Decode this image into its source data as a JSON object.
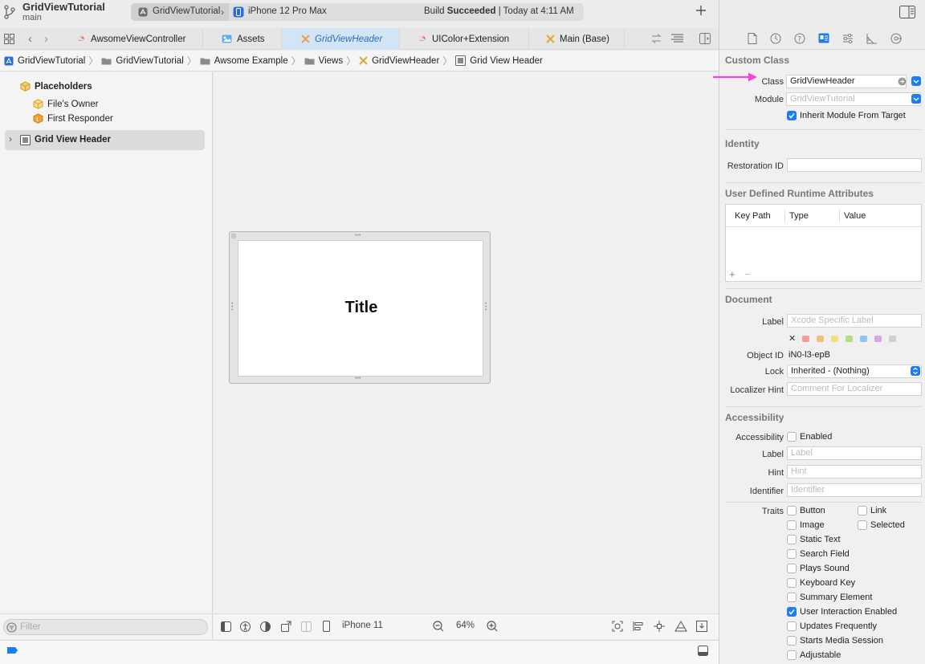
{
  "window": {
    "project_name": "GridViewTutorial",
    "branch": "main",
    "scheme": "GridViewTutorial",
    "device": "iPhone 12 Pro Max",
    "build_status_prefix": "Build ",
    "build_status_bold": "Succeeded",
    "build_status_suffix": " | Today at 4:11 AM"
  },
  "tabs": [
    {
      "label": "AwsomeViewController",
      "icon": "swift-icon"
    },
    {
      "label": "Assets",
      "icon": "assets-icon"
    },
    {
      "label": "GridViewHeader",
      "icon": "xib-icon",
      "active": true
    },
    {
      "label": "UIColor+Extension",
      "icon": "swift-icon"
    },
    {
      "label": "Main (Base)",
      "icon": "xib-icon"
    }
  ],
  "breadcrumb": [
    "GridViewTutorial",
    "GridViewTutorial",
    "Awsome Example",
    "Views",
    "GridViewHeader",
    "Grid View Header"
  ],
  "navigator": {
    "placeholders": "Placeholders",
    "files_owner": "File's Owner",
    "first_responder": "First Responder",
    "grid_view_header": "Grid View Header",
    "filter_placeholder": "Filter"
  },
  "canvas": {
    "view_title": "Title",
    "device": "iPhone 11",
    "zoom": "64%"
  },
  "inspector": {
    "custom_class": {
      "title": "Custom Class",
      "class_label": "Class",
      "class_value": "GridViewHeader",
      "module_label": "Module",
      "module_placeholder": "GridViewTutorial",
      "inherit_label": "Inherit Module From Target"
    },
    "identity": {
      "title": "Identity",
      "restoration_label": "Restoration ID"
    },
    "runtime_attrs": {
      "title": "User Defined Runtime Attributes",
      "col_keypath": "Key Path",
      "col_type": "Type",
      "col_value": "Value",
      "add": "+",
      "remove": "−"
    },
    "document": {
      "title": "Document",
      "label_label": "Label",
      "label_placeholder": "Xcode Specific Label",
      "object_id_label": "Object ID",
      "object_id_value": "iN0-l3-epB",
      "lock_label": "Lock",
      "lock_value": "Inherited - (Nothing)",
      "localizer_label": "Localizer Hint",
      "localizer_placeholder": "Comment For Localizer",
      "clear": "✕"
    },
    "accessibility": {
      "title": "Accessibility",
      "acc_label": "Accessibility",
      "enabled_label": "Enabled",
      "label_label": "Label",
      "label_placeholder": "Label",
      "hint_label": "Hint",
      "hint_placeholder": "Hint",
      "identifier_label": "Identifier",
      "identifier_placeholder": "Identifier",
      "traits_label": "Traits",
      "traits": {
        "button": "Button",
        "link": "Link",
        "image": "Image",
        "selected": "Selected",
        "static_text": "Static Text",
        "search_field": "Search Field",
        "plays_sound": "Plays Sound",
        "keyboard_key": "Keyboard Key",
        "summary_element": "Summary Element",
        "user_interaction": "User Interaction Enabled",
        "updates_frequently": "Updates Frequently",
        "starts_media": "Starts Media Session",
        "adjustable": "Adjustable"
      }
    }
  },
  "colors": {
    "accent": "#1e7cf2",
    "arrow": "#ff3fd5",
    "swift": "#f05138",
    "xib": "#e8a33a"
  }
}
